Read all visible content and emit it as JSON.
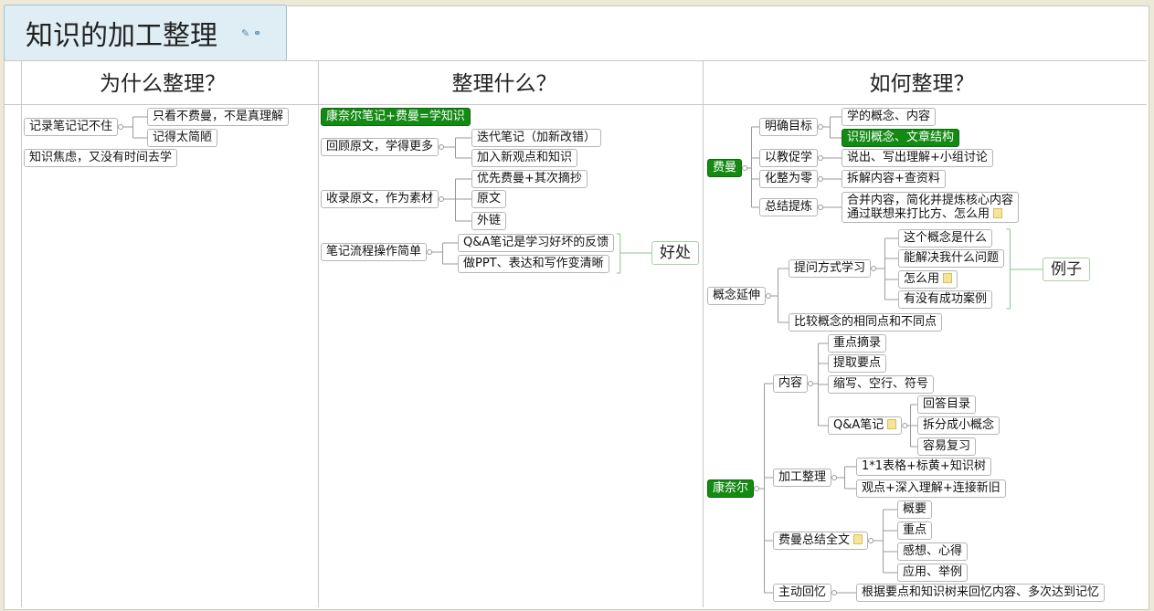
{
  "title": "知识的加工整理",
  "title_icons": [
    "pencil-icon",
    "link-icon"
  ],
  "columns": [
    {
      "header": "为什么整理？"
    },
    {
      "header": "整理什么？"
    },
    {
      "header": "如何整理？"
    }
  ],
  "nodes": {
    "c1a": "记录笔记记不住",
    "c1a1": "只看不费曼，不是真理解",
    "c1a2": "记得太简陋",
    "c1b": "知识焦虑，又没有时间去学",
    "c2a": "康奈尔笔记+费曼=学知识",
    "c2b": "回顾原文，学得更多",
    "c2b1": "迭代笔记（加新改错）",
    "c2b2": "加入新观点和知识",
    "c2c": "收录原文，作为素材",
    "c2c1": "优先费曼+其次摘抄",
    "c2c2": "原文",
    "c2c3": "外链",
    "c2d": "笔记流程操作简单",
    "c2d1": "Q&A笔记是学习好坏的反馈",
    "c2d2": "做PPT、表达和写作变清晰",
    "c2s": "好处",
    "f": "费曼",
    "f1": "明确目标",
    "f1a": "学的概念、内容",
    "f1b": "识别概念、文章结构",
    "f2": "以教促学",
    "f2a": "说出、写出理解+小组讨论",
    "f3": "化整为零",
    "f3a": "拆解内容+查资料",
    "f4": "总结提炼",
    "f4a_l1": "合并内容，简化并提炼核心内容",
    "f4a_l2": "通过联想来打比方、怎么用",
    "g": "概念延伸",
    "g1": "提问方式学习",
    "g1a": "这个概念是什么",
    "g1b": "能解决我什么问题",
    "g1c": "怎么用",
    "g1d": "有没有成功案例",
    "g1s": "例子",
    "g2": "比较概念的相同点和不同点",
    "k": "康奈尔",
    "k1": "内容",
    "k1a": "重点摘录",
    "k1b": "提取要点",
    "k1c": "缩写、空行、符号",
    "k1d": "Q&A笔记",
    "k1d1": "回答目录",
    "k1d2": "拆分成小概念",
    "k1d3": "容易复习",
    "k2": "加工整理",
    "k2a": "1*1表格+标黄+知识树",
    "k2b": "观点+深入理解+连接新旧",
    "k3": "费曼总结全文",
    "k3a": "概要",
    "k3b": "重点",
    "k3c": "感想、心得",
    "k3d": "应用、举例",
    "k4": "主动回忆",
    "k4a": "根据要点和知识树来回忆内容、多次达到记忆"
  },
  "notes": [
    "f4a",
    "g1c",
    "k1d",
    "k3"
  ],
  "colors": {
    "highlight": "#138a13",
    "title_bg": "#dfeef4",
    "grid": "#c9c9c9",
    "summary_border": "#aacfa8"
  }
}
